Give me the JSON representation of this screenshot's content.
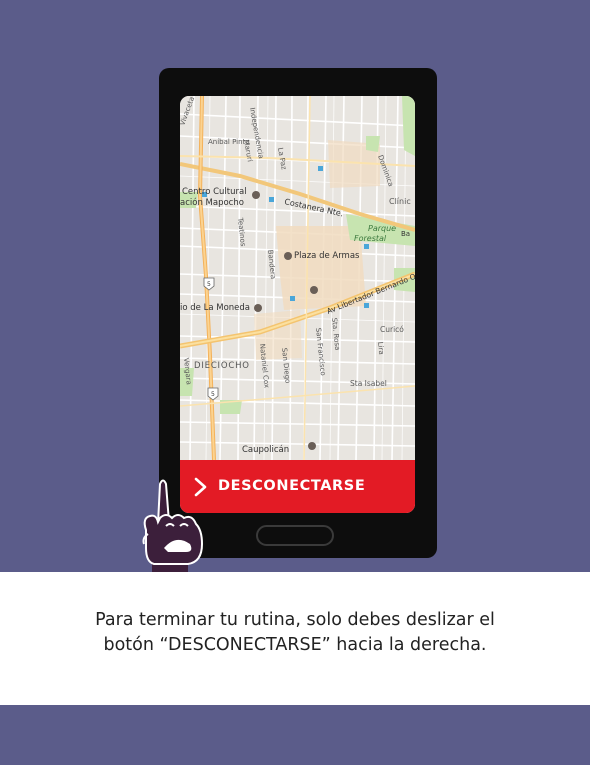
{
  "colors": {
    "background": "#5b5c8a",
    "phone_body": "#0d0d0d",
    "slider_red": "#e31b25",
    "hand": "#3c1f3b"
  },
  "map": {
    "labels": {
      "anibal_pinto": "Aníbal Pinto",
      "viscaya": "Vivaceta",
      "independencia": "Independencia",
      "maruri": "Maruri",
      "la_paz": "La Paz",
      "dominica": "Dominica",
      "clinica": "Clínic",
      "centro_cultural": "Centro Cultural",
      "estacion_mapocho": "ación Mapocho",
      "costanera": "Costanera Nte.",
      "parque_forestal_1": "Parque",
      "parque_forestal_2": "Forestal",
      "teatinos": "Teatinos",
      "plaza_de_armas": "Plaza de Armas",
      "bandera": "Bandera",
      "av_libertador": "Av Libertador Bernardo O'Higgins",
      "la_moneda": "io de La Moneda",
      "curico": "Curicó",
      "santa_rosa": "Sta. Rosa",
      "san_francisco": "San Francisco",
      "lira": "Lira",
      "dieciocho": "DIECIOCHO",
      "natiel_cox": "Nataniel Cox",
      "san_diego": "San Diego",
      "vergara": "Vergara",
      "santa_isabel": "Sta Isabel",
      "caupolican": "Caupolicán",
      "highway_5a": "5",
      "highway_5b": "5",
      "ba": "Ba"
    }
  },
  "slider": {
    "label": "DESCONECTARSE"
  },
  "caption": {
    "line1": "Para terminar tu rutina, solo debes deslizar el",
    "line2": "botón “DESCONECTARSE” hacia la derecha."
  }
}
